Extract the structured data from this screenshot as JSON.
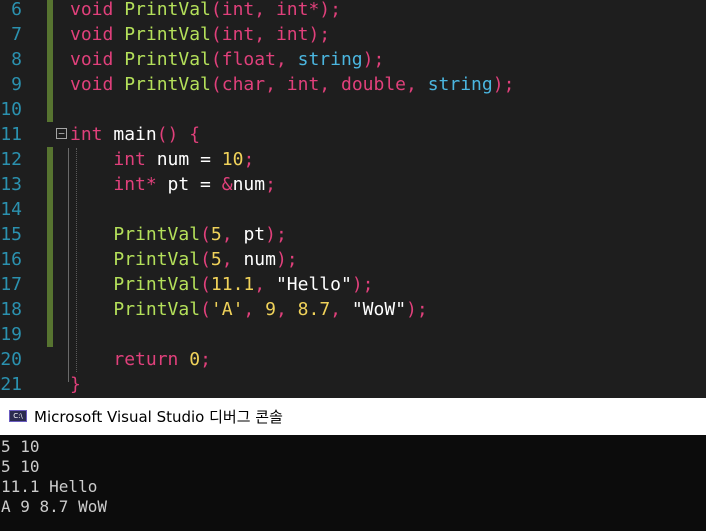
{
  "editor": {
    "line_numbers": [
      "6",
      "7",
      "8",
      "9",
      "10",
      "11",
      "12",
      "13",
      "14",
      "15",
      "16",
      "17",
      "18",
      "19",
      "20",
      "21"
    ],
    "lines": [
      [
        {
          "t": "void ",
          "c": "kw"
        },
        {
          "t": "PrintVal",
          "c": "fn"
        },
        {
          "t": "(",
          "c": "brace"
        },
        {
          "t": "int",
          "c": "kw"
        },
        {
          "t": ", ",
          "c": "brace"
        },
        {
          "t": "int*",
          "c": "kw"
        },
        {
          "t": ");",
          "c": "brace"
        }
      ],
      [
        {
          "t": "void ",
          "c": "kw"
        },
        {
          "t": "PrintVal",
          "c": "fn"
        },
        {
          "t": "(",
          "c": "brace"
        },
        {
          "t": "int",
          "c": "kw"
        },
        {
          "t": ", ",
          "c": "brace"
        },
        {
          "t": "int",
          "c": "kw"
        },
        {
          "t": ");",
          "c": "brace"
        }
      ],
      [
        {
          "t": "void ",
          "c": "kw"
        },
        {
          "t": "PrintVal",
          "c": "fn"
        },
        {
          "t": "(",
          "c": "brace"
        },
        {
          "t": "float",
          "c": "kw"
        },
        {
          "t": ", ",
          "c": "brace"
        },
        {
          "t": "string",
          "c": "ty"
        },
        {
          "t": ");",
          "c": "brace"
        }
      ],
      [
        {
          "t": "void ",
          "c": "kw"
        },
        {
          "t": "PrintVal",
          "c": "fn"
        },
        {
          "t": "(",
          "c": "brace"
        },
        {
          "t": "char",
          "c": "kw"
        },
        {
          "t": ", ",
          "c": "brace"
        },
        {
          "t": "int",
          "c": "kw"
        },
        {
          "t": ", ",
          "c": "brace"
        },
        {
          "t": "double",
          "c": "kw"
        },
        {
          "t": ", ",
          "c": "brace"
        },
        {
          "t": "string",
          "c": "ty"
        },
        {
          "t": ");",
          "c": "brace"
        }
      ],
      [],
      [
        {
          "t": "int ",
          "c": "kw"
        },
        {
          "t": "main",
          "c": "white"
        },
        {
          "t": "() {",
          "c": "brace"
        }
      ],
      [
        {
          "t": "    "
        },
        {
          "t": "int ",
          "c": "kw"
        },
        {
          "t": "num = ",
          "c": "white"
        },
        {
          "t": "10",
          "c": "num"
        },
        {
          "t": ";",
          "c": "brace"
        }
      ],
      [
        {
          "t": "    "
        },
        {
          "t": "int* ",
          "c": "kw"
        },
        {
          "t": "pt = ",
          "c": "white"
        },
        {
          "t": "&",
          "c": "brace"
        },
        {
          "t": "num",
          "c": "white"
        },
        {
          "t": ";",
          "c": "brace"
        }
      ],
      [],
      [
        {
          "t": "    "
        },
        {
          "t": "PrintVal",
          "c": "fn"
        },
        {
          "t": "(",
          "c": "brace"
        },
        {
          "t": "5",
          "c": "num"
        },
        {
          "t": ", ",
          "c": "brace"
        },
        {
          "t": "pt",
          "c": "white"
        },
        {
          "t": ");",
          "c": "brace"
        }
      ],
      [
        {
          "t": "    "
        },
        {
          "t": "PrintVal",
          "c": "fn"
        },
        {
          "t": "(",
          "c": "brace"
        },
        {
          "t": "5",
          "c": "num"
        },
        {
          "t": ", ",
          "c": "brace"
        },
        {
          "t": "num",
          "c": "white"
        },
        {
          "t": ");",
          "c": "brace"
        }
      ],
      [
        {
          "t": "    "
        },
        {
          "t": "PrintVal",
          "c": "fn"
        },
        {
          "t": "(",
          "c": "brace"
        },
        {
          "t": "11.1",
          "c": "num"
        },
        {
          "t": ", ",
          "c": "brace"
        },
        {
          "t": "\"Hello\"",
          "c": "white"
        },
        {
          "t": ");",
          "c": "brace"
        }
      ],
      [
        {
          "t": "    "
        },
        {
          "t": "PrintVal",
          "c": "fn"
        },
        {
          "t": "(",
          "c": "brace"
        },
        {
          "t": "'A'",
          "c": "str"
        },
        {
          "t": ", ",
          "c": "brace"
        },
        {
          "t": "9",
          "c": "num"
        },
        {
          "t": ", ",
          "c": "brace"
        },
        {
          "t": "8.7",
          "c": "num"
        },
        {
          "t": ", ",
          "c": "brace"
        },
        {
          "t": "\"WoW\"",
          "c": "white"
        },
        {
          "t": ");",
          "c": "brace"
        }
      ],
      [],
      [
        {
          "t": "    "
        },
        {
          "t": "return ",
          "c": "kw"
        },
        {
          "t": "0",
          "c": "num"
        },
        {
          "t": ";",
          "c": "brace"
        }
      ],
      [
        {
          "t": "}",
          "c": "brace"
        }
      ]
    ],
    "modified_lines": [
      0,
      1,
      2,
      3,
      4,
      6,
      7,
      8,
      9,
      10,
      11,
      12,
      13
    ],
    "collapse_toggle": "−"
  },
  "console": {
    "icon_text": "C:\\",
    "title": "Microsoft Visual Studio 디버그 콘솔",
    "output": [
      "5 10",
      "5 10",
      "11.1 Hello",
      "A 9 8.7 WoW"
    ]
  },
  "colors": {
    "editor_bg": "#1e1e1e",
    "line_number": "#2b91af",
    "keyword": "#e0407b",
    "function": "#b4e05a",
    "type": "#4bb6e0",
    "number": "#f0d25a",
    "modified_bar": "#577430",
    "console_bg": "#0c0c0c",
    "console_text": "#cccccc"
  }
}
